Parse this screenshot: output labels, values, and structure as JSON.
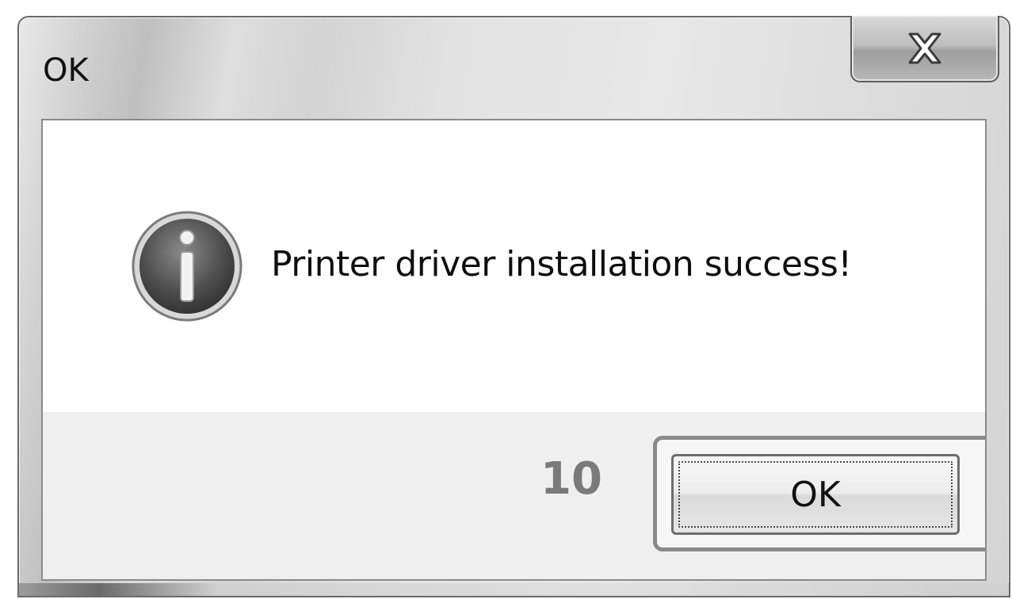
{
  "window": {
    "title": "OK"
  },
  "titlebar": {
    "close_icon": "close-x-icon"
  },
  "dialog": {
    "icon": "info-icon",
    "message": "Printer driver installation success!"
  },
  "footer": {
    "countdown": "10",
    "ok_label": "OK"
  }
}
